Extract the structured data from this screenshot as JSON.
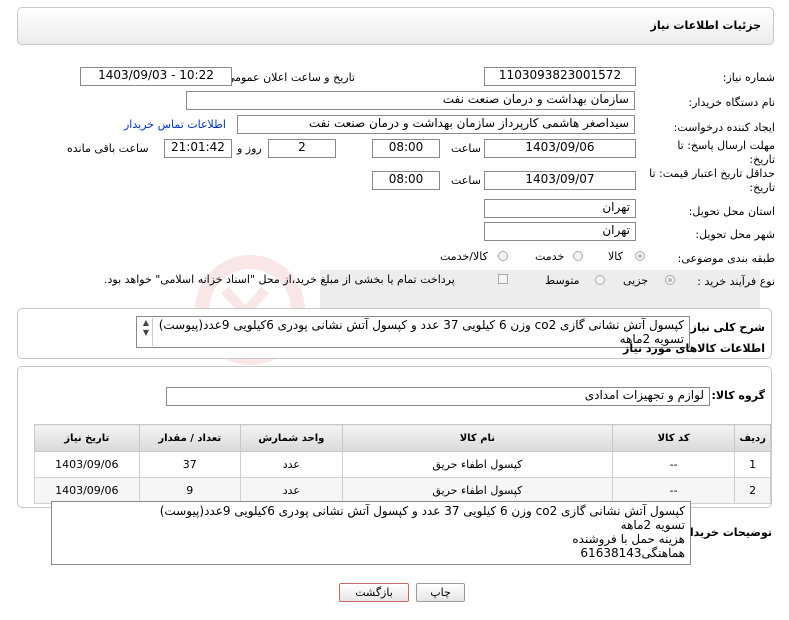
{
  "panel_title": "جزئیات اطلاعات نیاز",
  "need_number": {
    "label": "شماره نیاز:",
    "value": "1103093823001572"
  },
  "announce": {
    "label": "تاریخ و ساعت اعلان عمومی:",
    "value": "1403/09/03 - 10:22"
  },
  "buyer_org": {
    "label": "نام دستگاه خریدار:",
    "value": "سازمان بهداشت و درمان صنعت نفت"
  },
  "requester": {
    "label": "ایجاد کننده درخواست:",
    "value": "سیداصغر هاشمی کارپرداز سازمان بهداشت و درمان صنعت نفت",
    "contact_link": "اطلاعات تماس خریدار"
  },
  "reply_deadline": {
    "label": "مهلت ارسال پاسخ: تا تاریخ:",
    "date": "1403/09/06",
    "time_label": "ساعت",
    "time": "08:00",
    "days": "2",
    "days_label": "روز و",
    "remaining": "21:01:42",
    "remaining_label": "ساعت باقی مانده"
  },
  "price_validity": {
    "label": "حداقل تاریخ اعتبار قیمت: تا تاریخ:",
    "date": "1403/09/07",
    "time_label": "ساعت",
    "time": "08:00"
  },
  "province": {
    "label": "استان محل تحویل:",
    "value": "تهران"
  },
  "city": {
    "label": "شهر محل تحویل:",
    "value": "تهران"
  },
  "category": {
    "label": "طبقه بندی موضوعی:",
    "options": [
      "کالا",
      "خدمت",
      "کالا/خدمت"
    ]
  },
  "process": {
    "label": "نوع فرآیند خرید :",
    "options": [
      "جزیی",
      "متوسط"
    ],
    "note": "پرداخت تمام یا بخشی از مبلغ خرید،از محل \"اسناد خزانه اسلامی\" خواهد بود."
  },
  "description": {
    "label": "شرح کلی نیاز:",
    "line1": "کپسول آتش نشانی گازی co2 وزن 6 کیلویی 37 عدد و کپسول آتش نشانی پودری 6کیلویی 9عدد(پیوست)",
    "line2": "تسویه 2ماهه"
  },
  "goods_info_title": "اطلاعات کالاهای مورد نیاز",
  "goods_group": {
    "label": "گروه کالا:",
    "value": "لوازم و تجهیزات امدادی"
  },
  "table": {
    "headers": [
      "ردیف",
      "کد کالا",
      "نام کالا",
      "واحد شمارش",
      "تعداد / مقدار",
      "تاریخ نیاز"
    ],
    "rows": [
      [
        "1",
        "--",
        "کپسول اطفاء حریق",
        "عدد",
        "37",
        "1403/09/06"
      ],
      [
        "2",
        "--",
        "کپسول اطفاء حریق",
        "عدد",
        "9",
        "1403/09/06"
      ]
    ]
  },
  "buyer_notes": {
    "label": "توضیحات خریدار:",
    "lines": [
      "کپسول آتش نشانی گازی co2 وزن 6 کیلویی 37 عدد و کپسول آتش نشانی پودری 6کیلویی 9عدد(پیوست)",
      "تسویه 2ماهه",
      "هزینه حمل با فروشنده",
      "هماهنگی61638143"
    ]
  },
  "buttons": {
    "print": "چاپ",
    "back": "بازگشت"
  },
  "colors": {
    "link": "#0033cc",
    "border": "#8a8a8a",
    "back_button_border": "#cc6666"
  }
}
